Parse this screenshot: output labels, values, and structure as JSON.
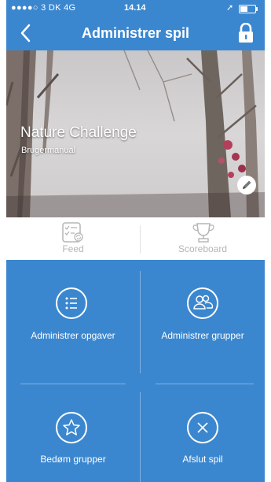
{
  "status_bar": {
    "carrier": "●●●●○ 3 DK  4G",
    "time": "14.14",
    "location_glyph": "➚"
  },
  "nav": {
    "title": "Administrer spil",
    "back_icon": "chevron-left-icon",
    "lock_icon": "lock-icon"
  },
  "game": {
    "title": "Nature Challenge",
    "subtitle": "Brugermanual",
    "edit_icon": "pencil-icon"
  },
  "tabs": [
    {
      "label": "Feed",
      "icon": "checklist-icon"
    },
    {
      "label": "Scoreboard",
      "icon": "trophy-icon"
    }
  ],
  "actions": [
    {
      "label": "Administrer opgaver",
      "icon": "list-icon"
    },
    {
      "label": "Administrer grupper",
      "icon": "group-icon"
    },
    {
      "label": "Bedøm grupper",
      "icon": "star-icon"
    },
    {
      "label": "Afslut spil",
      "icon": "close-icon"
    }
  ],
  "colors": {
    "primary": "#3b87cf",
    "tab_inactive": "#b5b5b5"
  }
}
